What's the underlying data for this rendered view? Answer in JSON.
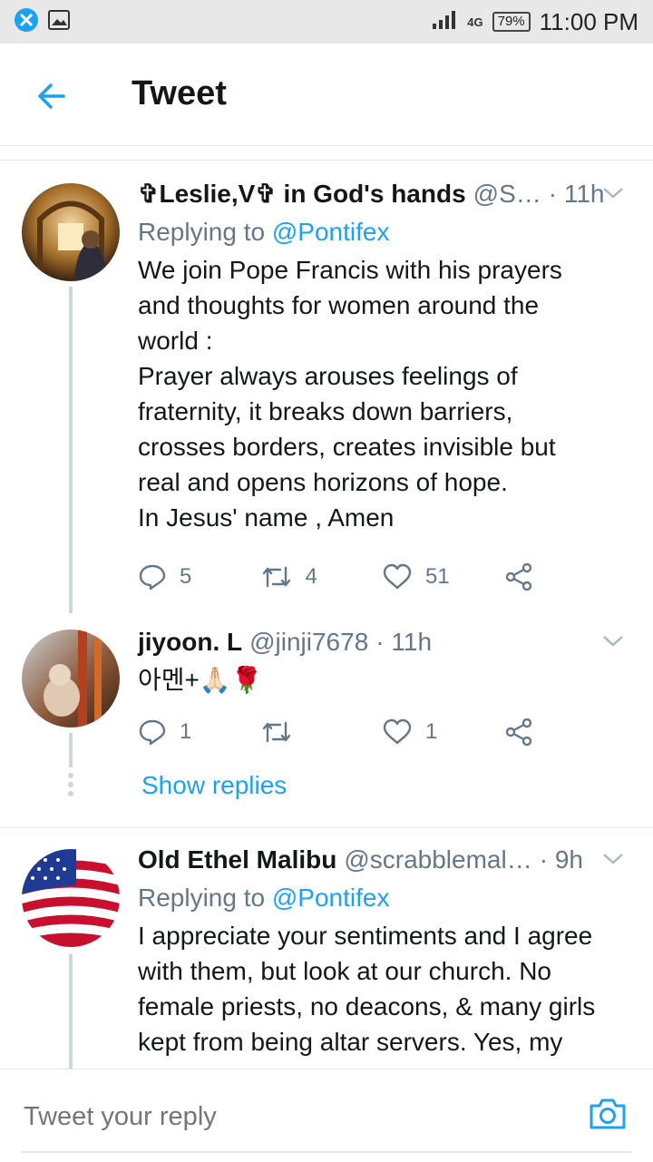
{
  "status_bar": {
    "signal": "4G",
    "battery": "79%",
    "time": "11:00 PM"
  },
  "header": {
    "title": "Tweet"
  },
  "tweets": [
    {
      "name": "✞Leslie,V✞ in God's hands",
      "handle": "@S…",
      "time": "· 11h",
      "replying_prefix": "Replying to ",
      "replying_handle": "@Pontifex",
      "text": "We join Pope Francis with his prayers\nand thoughts for women around the\nworld :\nPrayer always arouses feelings of\nfraternity, it breaks down barriers,\ncrosses borders, creates invisible but\nreal and opens horizons of hope.\nIn Jesus' name , Amen",
      "replies": "5",
      "retweets": "4",
      "likes": "51"
    },
    {
      "name": "jiyoon. L",
      "handle": "@jinji7678",
      "time": "· 11h",
      "text": "아멘+🙏🏻🌹",
      "replies": "1",
      "retweets": "",
      "likes": "1",
      "show_replies": "Show replies"
    },
    {
      "name": "Old Ethel Malibu",
      "handle": "@scrabblemal…",
      "time": "· 9h",
      "replying_prefix": "Replying to ",
      "replying_handle": "@Pontifex",
      "text": "I appreciate your sentiments and I agree\nwith them, but look at our church. No\nfemale priests, no deacons, & many girls\nkept from being altar servers. Yes, my"
    }
  ],
  "composer": {
    "placeholder": "Tweet your reply"
  },
  "colors": {
    "accent": "#1da1f2",
    "secondary_text": "#657786"
  }
}
